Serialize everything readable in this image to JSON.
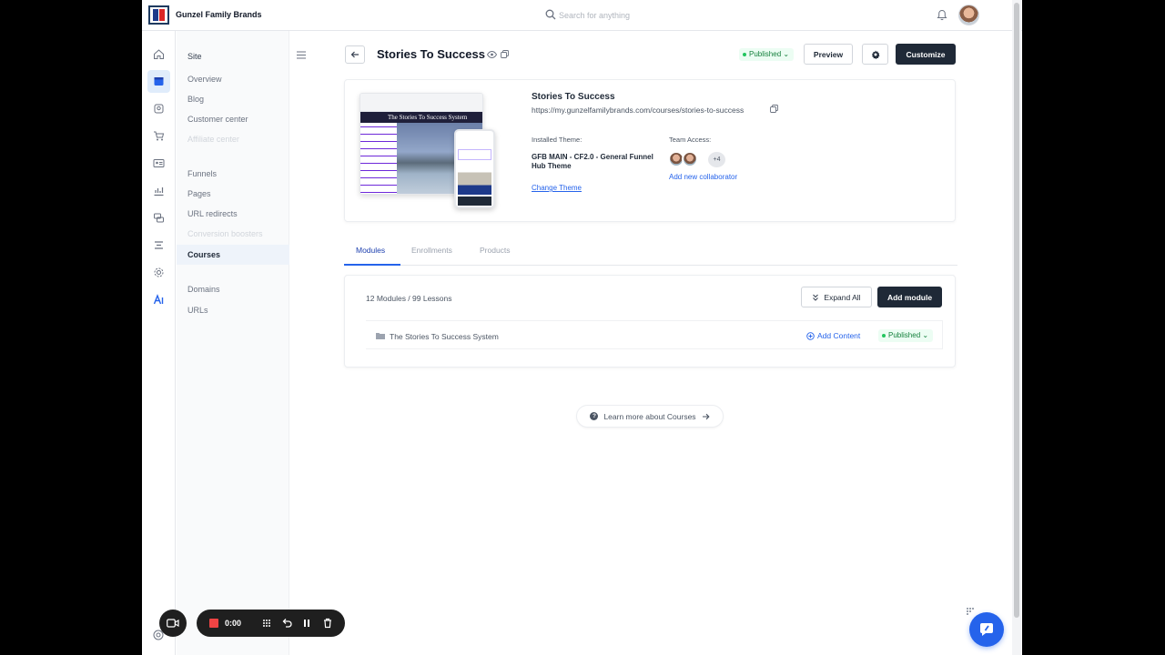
{
  "header": {
    "brand_name": "Gunzel Family Brands",
    "search_placeholder": "Search for anything"
  },
  "sidebar": {
    "items": [
      {
        "label": "Site",
        "type": "head"
      },
      {
        "label": "Overview",
        "type": "normal"
      },
      {
        "label": "Blog",
        "type": "normal"
      },
      {
        "label": "Customer center",
        "type": "normal"
      },
      {
        "label": "Affiliate center",
        "type": "disabled"
      },
      {
        "label": "Funnels",
        "type": "normal"
      },
      {
        "label": "Pages",
        "type": "normal"
      },
      {
        "label": "URL redirects",
        "type": "normal"
      },
      {
        "label": "Conversion boosters",
        "type": "disabled"
      },
      {
        "label": "Courses",
        "type": "active"
      },
      {
        "label": "Domains",
        "type": "normal"
      },
      {
        "label": "URLs",
        "type": "normal"
      }
    ]
  },
  "page": {
    "title": "Stories To Success",
    "status": "Published",
    "preview_label": "Preview",
    "customize_label": "Customize"
  },
  "course": {
    "name": "Stories To Success",
    "url": "https://my.gunzelfamilybrands.com/courses/stories-to-success",
    "installed_theme_label": "Installed Theme:",
    "theme_name": "GFB MAIN - CF2.0 - General Funnel Hub Theme",
    "change_theme_label": "Change Theme",
    "team_access_label": "Team Access:",
    "team_more": "+4",
    "add_collaborator_label": "Add new collaborator",
    "thumbnail_banner": "The Stories To Success System"
  },
  "tabs": [
    {
      "label": "Modules",
      "active": true
    },
    {
      "label": "Enrollments",
      "active": false
    },
    {
      "label": "Products",
      "active": false
    }
  ],
  "modules": {
    "count_text": "12 Modules / 99 Lessons",
    "expand_all_label": "Expand All",
    "add_module_label": "Add module",
    "rows": [
      {
        "name": "The Stories To Success System",
        "add_content_label": "Add Content",
        "status": "Published"
      }
    ]
  },
  "learn_more": {
    "label": "Learn more about Courses",
    "help_glyph": "?"
  },
  "recorder": {
    "time": "0:00"
  },
  "colors": {
    "accent": "#2563eb",
    "dark_button": "#1f2937",
    "published_green": "#15803d",
    "active_rail": "#e0ecfb"
  }
}
